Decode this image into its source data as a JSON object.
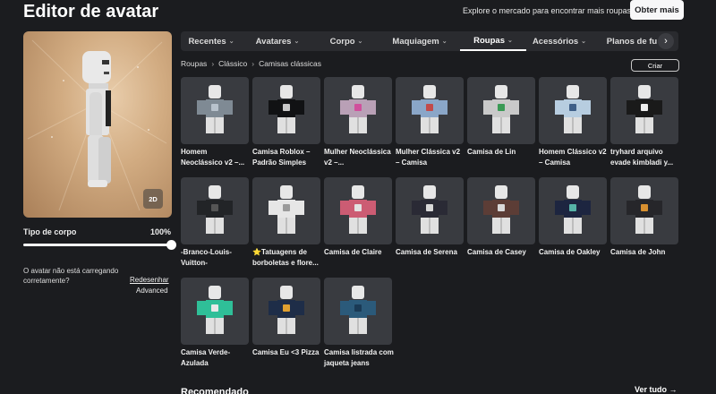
{
  "header": {
    "title": "Editor de avatar",
    "promo": "Explore o mercado para encontrar mais roupas!",
    "more_button": "Obter mais"
  },
  "preview": {
    "view_toggle": "2D"
  },
  "body_type": {
    "label": "Tipo de corpo",
    "value": "100%",
    "percent": 100
  },
  "warning": {
    "text": "O avatar não está carregando corretamente?",
    "redraw": "Redesenhar",
    "advanced": "Advanced"
  },
  "tabs": [
    {
      "label": "Recentes",
      "chevron": "chevron-down-icon"
    },
    {
      "label": "Avatares",
      "chevron": "chevron-down-icon"
    },
    {
      "label": "Corpo",
      "chevron": "chevron-down-icon"
    },
    {
      "label": "Maquiagem",
      "chevron": "chevron-down-icon"
    },
    {
      "label": "Roupas",
      "chevron": "chevron-down-icon",
      "active": true
    },
    {
      "label": "Acessórios",
      "chevron": "chevron-down-icon"
    },
    {
      "label": "Planos de fu",
      "chevron": ""
    }
  ],
  "breadcrumb": [
    "Roupas",
    "Clássico",
    "Camisas clássicas"
  ],
  "create_button": "Criar",
  "items": [
    {
      "name": "Homem Neoclássico v2 –...",
      "shirt": "#7f8a94",
      "accent": "#b8c2cc"
    },
    {
      "name": "Camisa Roblox – Padrão Simples",
      "shirt": "#111214",
      "accent": "#c8c8c8"
    },
    {
      "name": "Mulher Neoclássica v2 –...",
      "shirt": "#b9a0b6",
      "accent": "#d04f9c"
    },
    {
      "name": "Mulher Clássica v2 – Camisa",
      "shirt": "#8aa6c8",
      "accent": "#c24a4a"
    },
    {
      "name": "Camisa de Lin",
      "shirt": "#c9c9c9",
      "accent": "#3a9a55"
    },
    {
      "name": "Homem Clássico v2 – Camisa",
      "shirt": "#b7cde0",
      "accent": "#3f5f88"
    },
    {
      "name": "tryhard arquivo evade kimbladi y...",
      "shirt": "#1a1a1a",
      "accent": "#ededed"
    },
    {
      "name": "-Branco-Louis-Vuitton-",
      "shirt": "#222427",
      "accent": "#555"
    },
    {
      "name": "⭐Tatuagens de borboletas e flore...",
      "shirt": "#e6e6e6",
      "accent": "#9a9a9a"
    },
    {
      "name": "Camisa de Claire",
      "shirt": "#cc5c73",
      "accent": "#e2e2e2"
    },
    {
      "name": "Camisa de Serena",
      "shirt": "#2a2a35",
      "accent": "#d8d8d8"
    },
    {
      "name": "Camisa de Casey",
      "shirt": "#5c3d36",
      "accent": "#d9d9d9"
    },
    {
      "name": "Camisa de Oakley",
      "shirt": "#1d2540",
      "accent": "#56b4a8"
    },
    {
      "name": "Camisa de John",
      "shirt": "#26262a",
      "accent": "#d89030"
    },
    {
      "name": "Camisa Verde-Azulada",
      "shirt": "#2fbf98",
      "accent": "#e8e8e8"
    },
    {
      "name": "Camisa Eu <3 Pizza",
      "shirt": "#1e2d48",
      "accent": "#e0a030"
    },
    {
      "name": "Camisa listrada com jaqueta jeans",
      "shirt": "#2b5a7a",
      "accent": "#1a3a55"
    }
  ],
  "recommended": {
    "title": "Recomendado",
    "see_all": "Ver tudo →"
  }
}
